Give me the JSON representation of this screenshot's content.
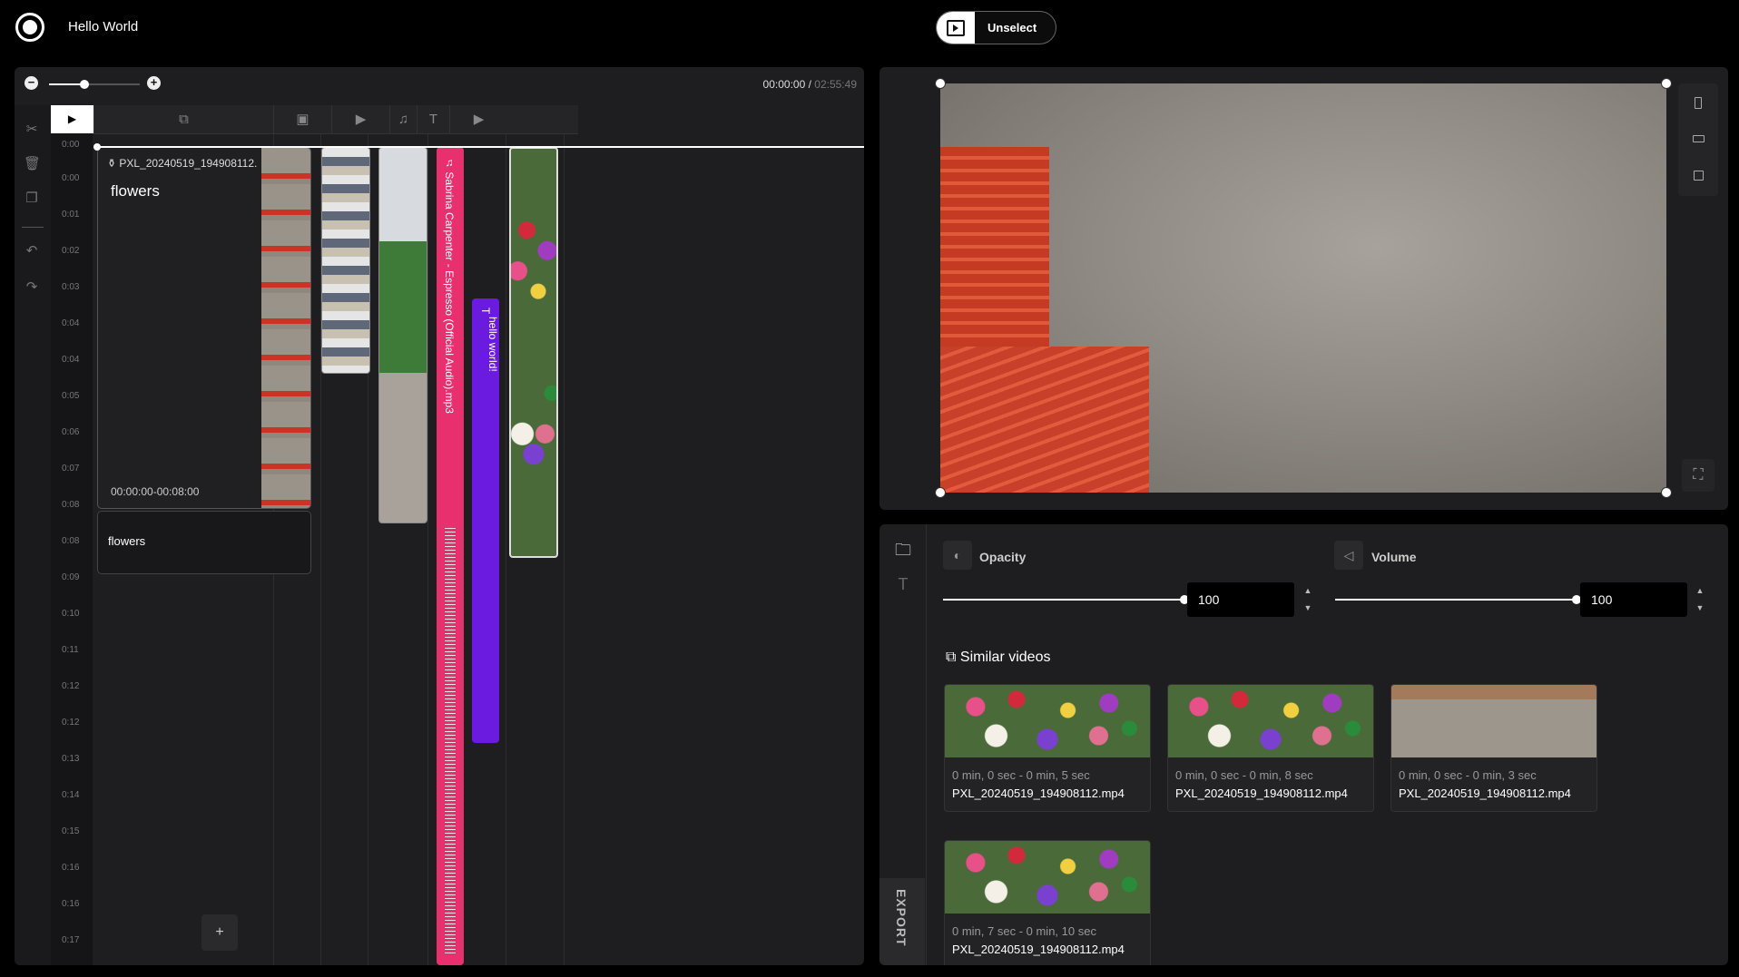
{
  "app": {
    "project_title": "Hello World",
    "unselect_label": "Unselect"
  },
  "timeline": {
    "current_time": "00:00:00",
    "separator": " / ",
    "total_time": "02:55:49",
    "zoom_level": 0.38,
    "ruler": [
      "0:00",
      "0:00",
      "0:01",
      "0:02",
      "0:03",
      "0:04",
      "0:04",
      "0:05",
      "0:06",
      "0:07",
      "0:08",
      "0:08",
      "0:09",
      "0:10",
      "0:11",
      "0:12",
      "0:12",
      "0:13",
      "0:14",
      "0:15",
      "0:16",
      "0:16",
      "0:17"
    ],
    "main_clip": {
      "filename": "PXL_20240519_194908112.",
      "title": "flowers",
      "range": "00:00:00-00:08:00"
    },
    "caption_clip": {
      "text": "flowers"
    },
    "audio_clip": {
      "label": "Sabrina Carpenter - Espresso (Official Audio).mp3"
    },
    "text_clip": {
      "label": "hello world!"
    },
    "add_label": "+"
  },
  "properties": {
    "opacity": {
      "label": "Opacity",
      "value": "100"
    },
    "volume": {
      "label": "Volume",
      "value": "100"
    },
    "similar_title": "Similar videos",
    "similar_videos": [
      {
        "range": "0 min, 0 sec - 0 min, 5 sec",
        "name": "PXL_20240519_194908112.mp4"
      },
      {
        "range": "0 min, 0 sec - 0 min, 8 sec",
        "name": "PXL_20240519_194908112.mp4"
      },
      {
        "range": "0 min, 0 sec - 0 min, 3 sec",
        "name": "PXL_20240519_194908112.mp4"
      },
      {
        "range": "0 min, 7 sec - 0 min, 10 sec",
        "name": "PXL_20240519_194908112.mp4"
      }
    ],
    "export_label": "EXPORT"
  }
}
